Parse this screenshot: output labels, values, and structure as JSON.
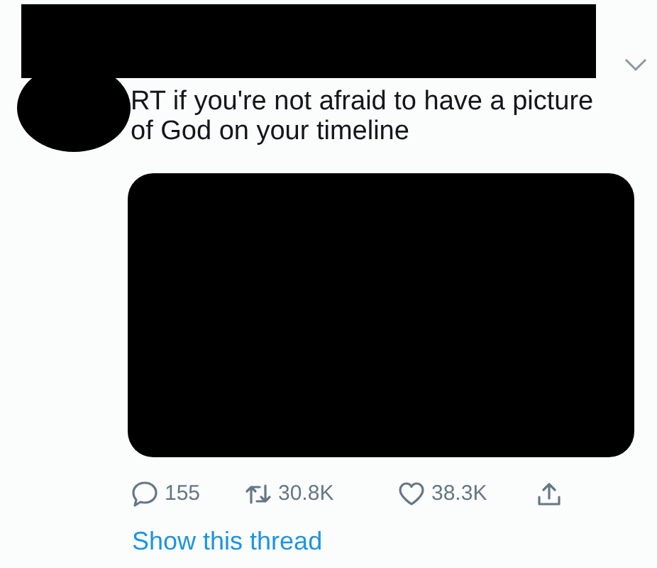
{
  "tweet": {
    "text": "RT if you're not afraid to have a picture of God on your timeline",
    "actions": [
      {
        "kind": "reply",
        "count": "155"
      },
      {
        "kind": "retweet",
        "count": "30.8K"
      },
      {
        "kind": "like",
        "count": "38.3K"
      },
      {
        "kind": "share"
      }
    ],
    "thread_link": "Show this thread"
  }
}
